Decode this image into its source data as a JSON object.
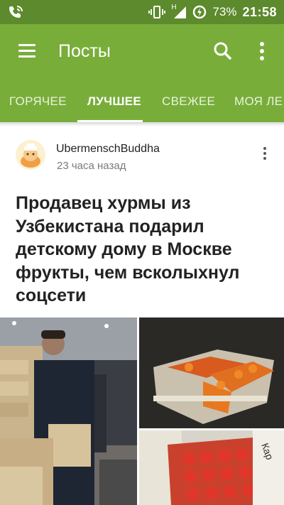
{
  "status_bar": {
    "vibrate_icon": "vibrate-icon",
    "signal_letter": "H",
    "battery": "73%",
    "time": "21:58"
  },
  "app_bar": {
    "title": "Посты",
    "menu_icon": "hamburger-menu-icon",
    "search_icon": "search-icon",
    "overflow_icon": "more-vert-icon"
  },
  "tabs": [
    {
      "label": "ГОРЯЧЕЕ",
      "active": false
    },
    {
      "label": "ЛУЧШЕЕ",
      "active": true
    },
    {
      "label": "СВЕЖЕЕ",
      "active": false
    },
    {
      "label": "МОЯ ЛЕ",
      "active": false
    }
  ],
  "post": {
    "author": "UbermenschBuddha",
    "time_ago": "23 часа назад",
    "title": "Продавец хурмы из Узбекистана подарил детскому дому в Москве фрукты, чем всколыхнул соцсети",
    "photo_right_bottom_text": "Кар"
  },
  "colors": {
    "status_bar": "#5d8a2c",
    "app_bar": "#78ad3a",
    "tab_text_inactive": "#e8f3da"
  }
}
